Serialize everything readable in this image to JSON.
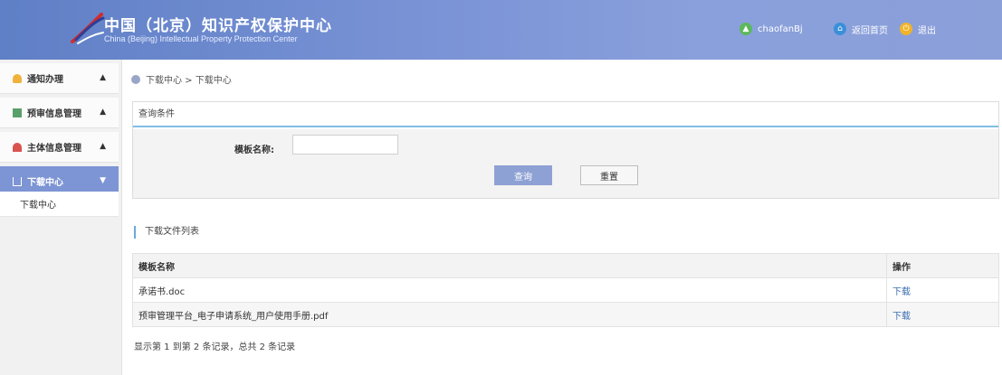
{
  "header": {
    "title_cn": "中国（北京）知识产权保护中心",
    "title_en": "China (Beijing) Intellectual Property Protection Center",
    "user": "chaofanBj",
    "home_label": "返回首页",
    "logout_label": "退出"
  },
  "sidebar": {
    "items": [
      {
        "label": "通知办理",
        "icon": "bell-icon",
        "color": "#f0b23a"
      },
      {
        "label": "预审信息管理",
        "icon": "document-icon",
        "color": "#5aa06a"
      },
      {
        "label": "主体信息管理",
        "icon": "user-icon",
        "color": "#d9534f"
      },
      {
        "label": "下载中心",
        "icon": "download-icon",
        "color": "#ffffff"
      }
    ],
    "sub_items": [
      {
        "label": "下载中心"
      }
    ]
  },
  "breadcrumb": {
    "path": "下载中心 > 下载中心"
  },
  "query": {
    "title": "查询条件",
    "label": "模板名称:",
    "value": "",
    "placeholder": "",
    "search_label": "查询",
    "reset_label": "重置"
  },
  "list": {
    "title": "下载文件列表",
    "columns": [
      "模板名称",
      "操作"
    ],
    "rows": [
      {
        "name": "承诺书.doc",
        "action": "下载"
      },
      {
        "name": "预审管理平台_电子申请系统_用户使用手册.pdf",
        "action": "下载"
      }
    ],
    "summary": "显示第 1 到第 2 条记录，总共 2 条记录"
  },
  "colors": {
    "header_bg": "#7b94d6",
    "active_nav": "#7d95d4",
    "primary_button": "#8ea1d4",
    "link": "#3a6db0"
  }
}
